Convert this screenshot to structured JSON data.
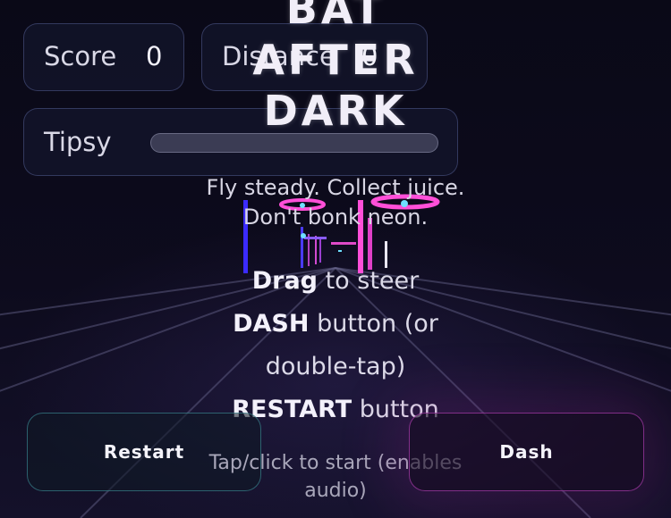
{
  "game": {
    "title_lines": [
      "BAT",
      "AFTER",
      "DARK"
    ],
    "tagline": "Fly steady. Collect juice. Don't bonk neon.",
    "instructions": {
      "drag_key": "Drag",
      "drag_text": "to steer",
      "dash_key": "DASH",
      "dash_text": "button (or double-tap)",
      "restart_key": "RESTART",
      "restart_text": "button"
    },
    "start_hint": "Tap/click to start (enables audio)"
  },
  "hud": {
    "score_label": "Score",
    "score_value": "0",
    "distance_label": "Distance",
    "distance_value": "0",
    "tipsy_label": "Tipsy",
    "tipsy_level": 0
  },
  "controls": {
    "restart_label": "Restart",
    "dash_label": "Dash"
  },
  "colors": {
    "background": "#0b0a18",
    "neon_pink": "#ff4fd8",
    "neon_blue": "#3b2bff",
    "juice_cyan": "#6fe0ff",
    "restart_border": "#46a0aa",
    "dash_border": "#c846c8"
  }
}
